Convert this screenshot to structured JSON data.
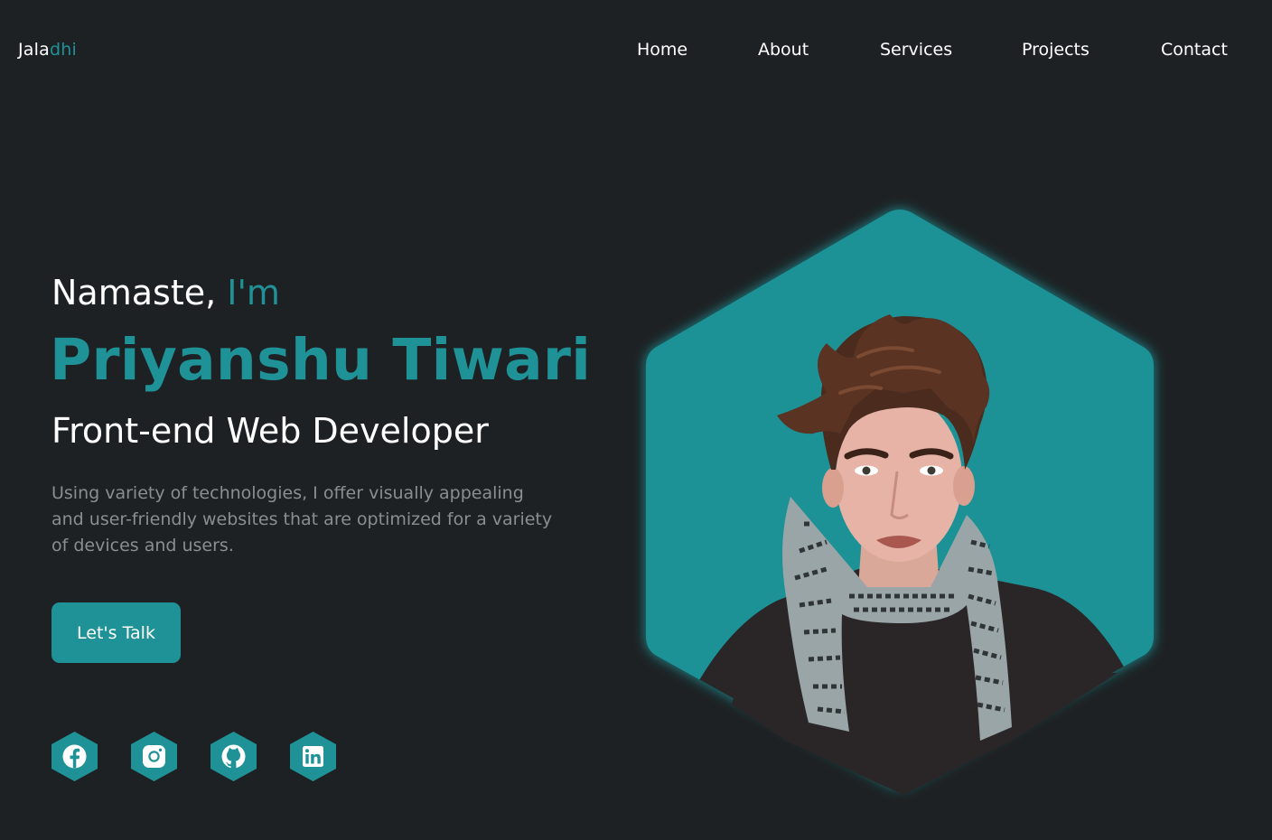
{
  "header": {
    "logo_primary": "Jala",
    "logo_accent": "dhi",
    "nav": [
      "Home",
      "About",
      "Services",
      "Projects",
      "Contact"
    ]
  },
  "hero": {
    "greeting": "Namaste,",
    "greeting_accent": "I'm",
    "name": "Priyanshu Tiwari",
    "role": "Front-end Web Developer",
    "description": "Using variety of technologies, I offer visually appealing and user-friendly websites that are optimized for a variety of devices and users.",
    "cta_label": "Let's Talk"
  },
  "socials": [
    {
      "icon": "facebook-icon"
    },
    {
      "icon": "instagram-icon"
    },
    {
      "icon": "github-icon"
    },
    {
      "icon": "linkedin-icon"
    }
  ],
  "colors": {
    "background": "#1e2123",
    "accent": "#1f9297",
    "text": "#ffffff",
    "muted": "#8a8e90"
  }
}
